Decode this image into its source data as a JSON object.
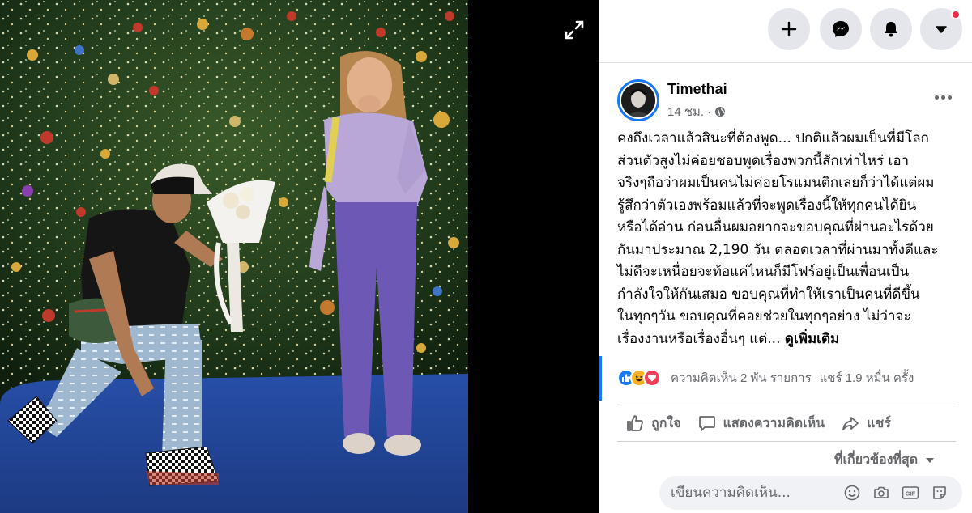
{
  "topbar": {
    "create_icon": "plus-icon",
    "messenger_icon": "messenger-icon",
    "notifications_icon": "bell-icon",
    "account_icon": "caret-down-icon",
    "badge_color": "#f02849"
  },
  "viewer": {
    "expand_icon": "expand-icon"
  },
  "post": {
    "author": "Timethai",
    "time": "14 ชม.",
    "privacy_icon": "globe-icon",
    "caption_lines": [
      "คงถึงเวลาแล้วสินะที่ต้องพูด... ปกติแล้วผมเป็นที่มีโลก",
      "ส่วนตัวสูงไม่ค่อยชอบพูดเรื่องพวกนี้สักเท่าไหร่ เอา",
      "จริงๆถือว่าผมเป็นคนไม่ค่อยโรแมนติกเลยก็ว่าได้แต่ผม",
      "รู้สึกว่าตัวเองพร้อมแล้วที่จะพูดเรื่องนี้ให้ทุกคนได้ยิน",
      "หรือได้อ่าน ก่อนอื่นผมอยากจะขอบคุณที่ผ่านอะไรด้วย",
      "กันมาประมาณ 2,190 วัน ตลอดเวลาที่ผ่านมาทั้งดีและ",
      "ไม่ดีจะเหนื่อยจะท้อแค่ไหนก็มีโฟร์อยู่เป็นเพื่อนเป็น",
      "กำลังใจให้กันเสมอ ขอบคุณที่ทำให้เราเป็นคนที่ดีขึ้น",
      "ในทุกๆวัน ขอบคุณที่คอยช่วยในทุกๆอย่าง ไม่ว่าจะ"
    ],
    "caption_last_line": "เรื่องงานหรือเรื่องอื่นๆ แต่...",
    "see_more": "ดูเพิ่มเติม"
  },
  "stats": {
    "comments": "ความคิดเห็น 2 พัน รายการ",
    "shares": "แชร์ 1.9 หมื่น ครั้ง",
    "reaction_icons": [
      "like-reaction-icon",
      "haha-reaction-icon",
      "love-reaction-icon"
    ]
  },
  "actions": {
    "like": "ถูกใจ",
    "comment": "แสดงความคิดเห็น",
    "share": "แชร์"
  },
  "sort": {
    "label": "ที่เกี่ยวข้องที่สุด"
  },
  "comment_box": {
    "placeholder": "เขียนความคิดเห็น..."
  },
  "colors": {
    "accent": "#1877f2",
    "muted_text": "#65676b",
    "button_bg": "#e4e6eb"
  }
}
